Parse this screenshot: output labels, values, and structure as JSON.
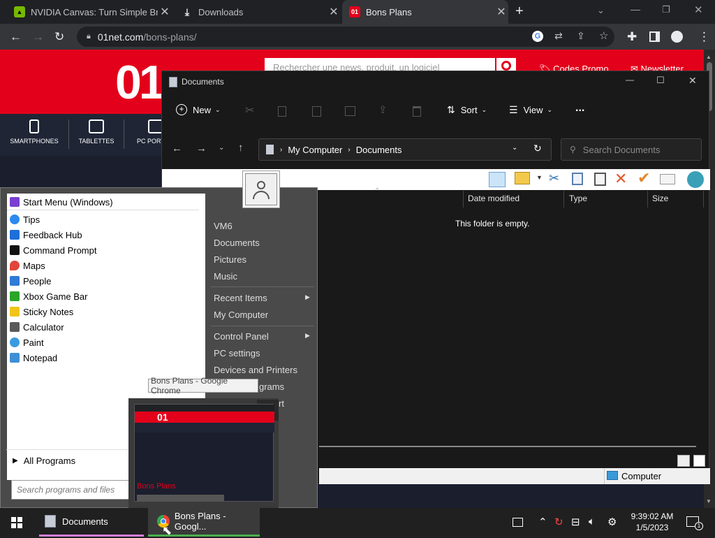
{
  "browser": {
    "tabs": [
      {
        "label": "NVIDIA Canvas: Turn Simple Brus",
        "icon": "nvidia-icon"
      },
      {
        "label": "Downloads",
        "icon": "download-icon"
      },
      {
        "label": "Bons Plans",
        "icon": "01net-icon",
        "favicon_text": "01"
      }
    ],
    "url_domain": "01net.com",
    "url_path": "/bons-plans/",
    "accent": "#e3001b"
  },
  "website": {
    "logo": "01",
    "search_placeholder": "Rechercher une news, produit, un logiciel",
    "promo_link": "Codes Promo",
    "newsletter_link": "Newsletter",
    "categories": [
      "SMARTPHONES",
      "TABLETTES",
      "PC PORTA"
    ]
  },
  "explorer": {
    "title": "Documents",
    "commands": {
      "new": "New",
      "sort": "Sort",
      "view": "View",
      "more": "..."
    },
    "path": [
      "My Computer",
      "Documents"
    ],
    "search_placeholder": "Search Documents",
    "columns": [
      "Date modified",
      "Type",
      "Size"
    ],
    "empty_message": "This folder is empty.",
    "status_location": "Computer"
  },
  "start_menu": {
    "pinned": [
      {
        "label": "Start Menu (Windows)",
        "color": "#7a3fd0"
      },
      {
        "label": "Tips",
        "color": "#2d89ef"
      },
      {
        "label": "Feedback Hub",
        "color": "#1e6fd9"
      },
      {
        "label": "Command Prompt",
        "color": "#111111"
      },
      {
        "label": "Maps",
        "color": "#e0463a"
      },
      {
        "label": "People",
        "color": "#2f7bd6"
      },
      {
        "label": "Xbox Game Bar",
        "color": "#2aa52a"
      },
      {
        "label": "Sticky Notes",
        "color": "#f0c419"
      },
      {
        "label": "Calculator",
        "color": "#5a5a5a"
      },
      {
        "label": "Paint",
        "color": "#3b9be0"
      },
      {
        "label": "Notepad",
        "color": "#3f8fd6"
      }
    ],
    "all_programs": "All Programs",
    "search_placeholder": "Search programs and files",
    "right_items": [
      "VM6",
      "Documents",
      "Pictures",
      "Music",
      "Recent Items",
      "My Computer",
      "Control Panel",
      "PC settings",
      "Devices and Printers",
      "grams",
      "rt"
    ]
  },
  "tooltip": "Bons Plans - Google Chrome",
  "thumbnail": {
    "logo": "01",
    "label": "Bons Plans"
  },
  "taskbar": {
    "items": [
      {
        "label": "Documents"
      },
      {
        "label": "Bons Plans - Googl..."
      }
    ],
    "time": "9:39:02 AM",
    "date": "1/5/2023",
    "notification_count": "1"
  }
}
